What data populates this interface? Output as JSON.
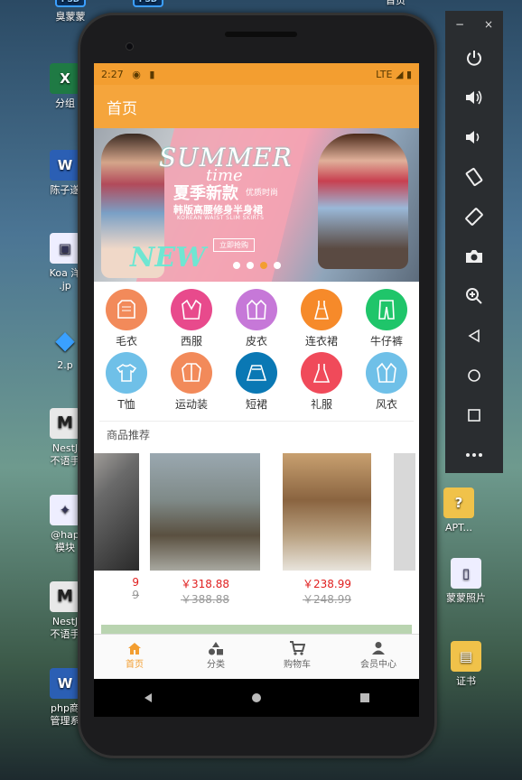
{
  "desktop": {
    "left_icons": [
      {
        "name": "psd-file-1",
        "label": "臭蒙蒙",
        "icon": "PSD"
      },
      {
        "name": "excel-file",
        "label": "分组",
        "icon": "X"
      },
      {
        "name": "word-file-1",
        "label": "陈子遂",
        "icon": "W"
      },
      {
        "name": "image-file",
        "label": "Koa 洋\n.jp",
        "icon": "img"
      },
      {
        "name": "shape-file",
        "label": "2.p",
        "icon": "◆"
      },
      {
        "name": "m-file-1",
        "label": "NestJ\n不语手",
        "icon": "M"
      },
      {
        "name": "hap-file",
        "label": "@hap\n模块",
        "icon": "✦"
      },
      {
        "name": "m-file-2",
        "label": "NestJ\n不语手",
        "icon": "M"
      },
      {
        "name": "word-file-2",
        "label": "php商\n管理系",
        "icon": "W"
      }
    ],
    "top_icons": [
      {
        "name": "psd-file-2",
        "label": "",
        "icon": "PSD"
      },
      {
        "name": "top-file-3",
        "label": "首页",
        "icon": ""
      }
    ],
    "right_icons": [
      {
        "name": "apt-file",
        "label": "APT..."
      },
      {
        "name": "mengmeng-photos",
        "label": "蒙蒙照片"
      },
      {
        "name": "certificate-folder",
        "label": "证书"
      }
    ]
  },
  "phone": {
    "status": {
      "time": "2:27",
      "network": "LTE"
    },
    "app_title": "首页",
    "banner": {
      "title_script": "SUMMER",
      "subtitle_script": "time",
      "headline": "夏季新款",
      "tag": "优质时尚",
      "line2": "韩版高腰修身半身裙",
      "english": "KOREAN WAIST SLIM SKIRTS",
      "button": "立即抢购",
      "new_text": "NEW",
      "slide_count": 4,
      "active_slide": 3
    },
    "categories": [
      {
        "label": "毛衣",
        "color": "#f28a5a"
      },
      {
        "label": "西服",
        "color": "#e84a8c"
      },
      {
        "label": "皮衣",
        "color": "#c678d8"
      },
      {
        "label": "连衣裙",
        "color": "#f68a2a"
      },
      {
        "label": "牛仔裤",
        "color": "#1fc56a"
      },
      {
        "label": "T恤",
        "color": "#6fc0e8"
      },
      {
        "label": "运动装",
        "color": "#f28a5a"
      },
      {
        "label": "短裙",
        "color": "#0a78b4"
      },
      {
        "label": "礼服",
        "color": "#f04a5a"
      },
      {
        "label": "风衣",
        "color": "#6fc0e8"
      }
    ],
    "section_title": "商品推荐",
    "products": [
      {
        "price": "9",
        "old_price": "9",
        "colors": [
          "#d8cfc8",
          "#3a3a3a"
        ]
      },
      {
        "price": "￥318.88",
        "old_price": "￥388.88",
        "colors": [
          "#7f9aa8",
          "#4a4a40"
        ]
      },
      {
        "price": "￥238.99",
        "old_price": "￥248.99",
        "colors": [
          "#b48a5a",
          "#e8e0d0"
        ]
      }
    ],
    "tabs": [
      {
        "label": "首页",
        "icon": "home-icon",
        "active": true
      },
      {
        "label": "分类",
        "icon": "category-icon",
        "active": false
      },
      {
        "label": "购物车",
        "icon": "cart-icon",
        "active": false
      },
      {
        "label": "会员中心",
        "icon": "user-icon",
        "active": false
      }
    ]
  },
  "emulator": {
    "window_controls": [
      "−",
      "×"
    ],
    "buttons": [
      "power-icon",
      "volume-up-icon",
      "volume-down-icon",
      "rotate-left-icon",
      "rotate-right-icon",
      "camera-icon",
      "zoom-icon",
      "back-icon",
      "home-icon",
      "overview-icon",
      "more-icon"
    ]
  },
  "colors": {
    "accent": "#f5a53c",
    "price": "#e02020"
  }
}
